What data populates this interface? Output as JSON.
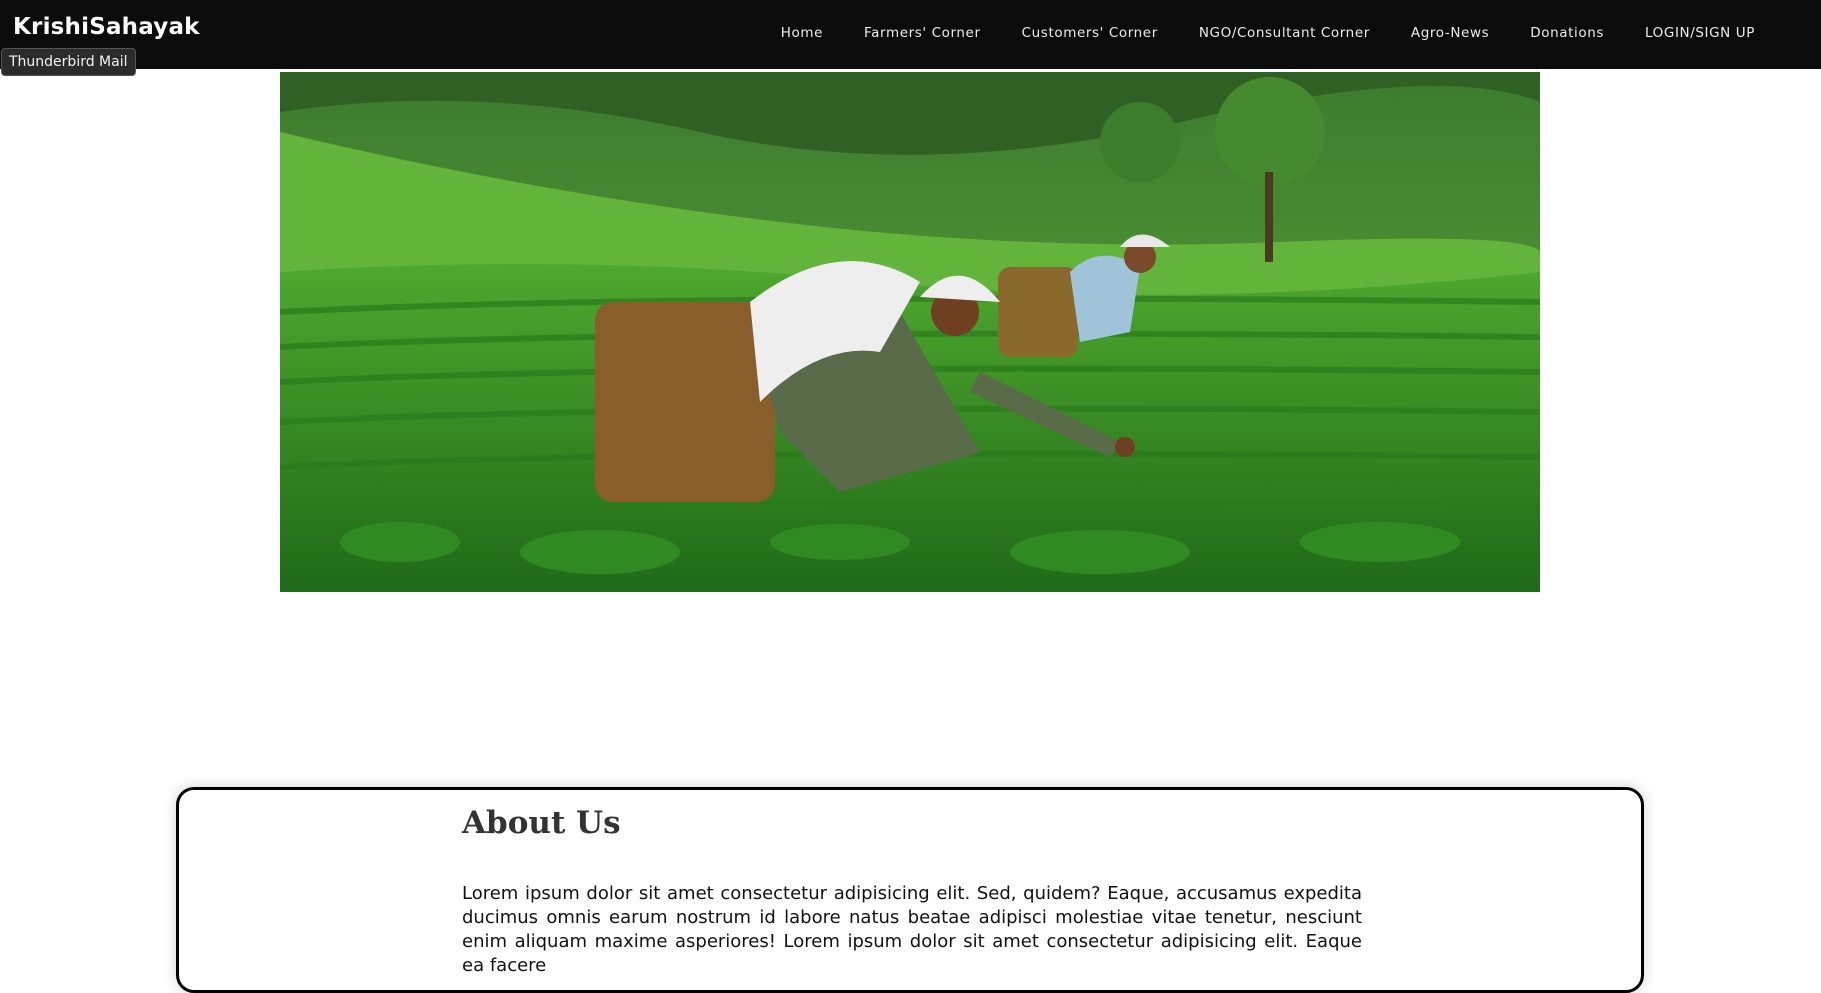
{
  "navbar": {
    "brand": "KrishiSahayak",
    "tooltip": "Thunderbird Mail",
    "links": [
      {
        "label": "Home"
      },
      {
        "label": "Farmers' Corner"
      },
      {
        "label": "Customers' Corner"
      },
      {
        "label": "NGO/Consultant Corner"
      },
      {
        "label": "Agro-News"
      },
      {
        "label": "Donations"
      },
      {
        "label": "LOGIN/SIGN UP"
      }
    ]
  },
  "about": {
    "title": "About Us",
    "text": "Lorem ipsum dolor sit amet consectetur adipisicing elit. Sed, quidem? Eaque, accusamus expedita ducimus omnis earum nostrum id labore natus beatae adipisci molestiae vitae tenetur, nesciunt enim aliquam maxime asperiores! Lorem ipsum dolor sit amet consectetur adipisicing elit. Eaque ea facere"
  },
  "colors": {
    "navbar_bg": "#0b0b0b",
    "nav_text": "#ececec",
    "card_border": "#000000"
  }
}
